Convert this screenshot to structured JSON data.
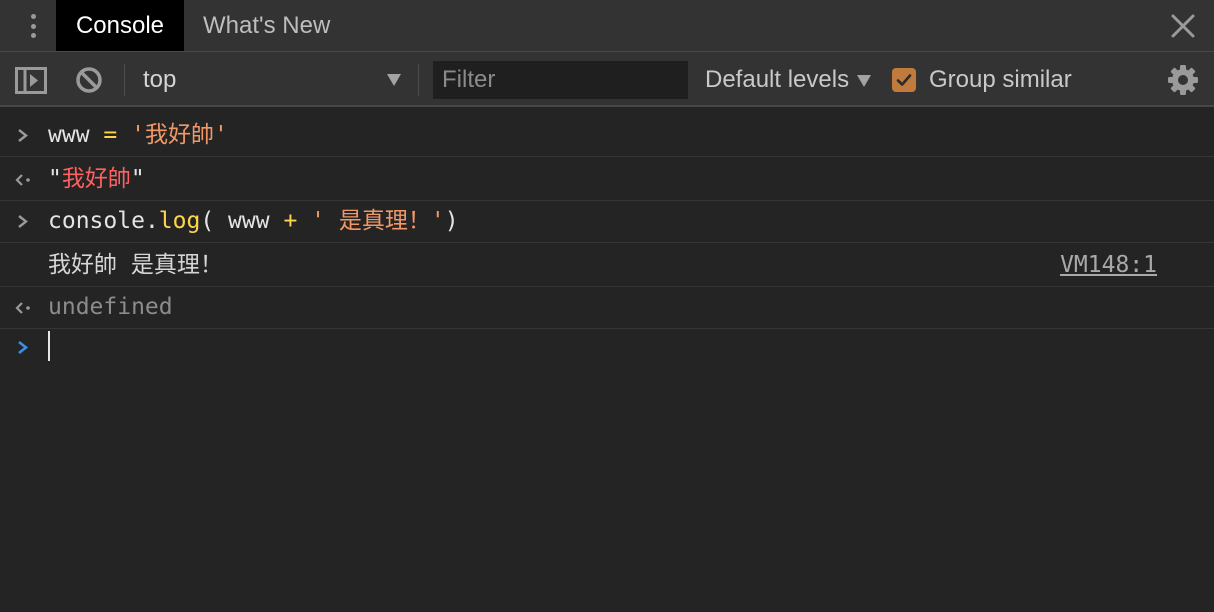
{
  "tabs": [
    {
      "label": "Console",
      "active": true
    },
    {
      "label": "What's New",
      "active": false
    }
  ],
  "toolbar": {
    "context": "top",
    "filter_placeholder": "Filter",
    "levels": "Default levels",
    "group_similar_label": "Group similar",
    "group_similar_checked": true
  },
  "console": {
    "line1": {
      "name": "www",
      "op": " = ",
      "str": "'我好帥'"
    },
    "line2": {
      "q1": "\"",
      "value": "我好帥",
      "q2": "\""
    },
    "line3": {
      "obj": "console",
      "dot": ".",
      "method": "log",
      "open": "( ",
      "name": "www",
      "plus": " + ",
      "str": "' 是真理！'",
      "close": ")"
    },
    "line4": {
      "text": "我好帥 是真理！",
      "source": "VM148:1"
    },
    "line5": {
      "text": "undefined"
    }
  },
  "colors": {
    "accent_checkbox": "#c07a3c",
    "string_orange": "#f29766",
    "method_yellow": "#ffd54d",
    "result_red": "#ff6060",
    "prompt_blue": "#3b8eea"
  }
}
